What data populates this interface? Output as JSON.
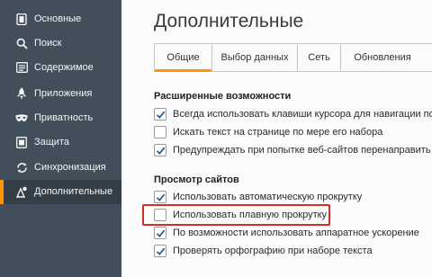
{
  "sidebar": {
    "items": [
      {
        "label": "Основные",
        "icon": "general-icon"
      },
      {
        "label": "Поиск",
        "icon": "search-icon"
      },
      {
        "label": "Содержимое",
        "icon": "content-icon"
      },
      {
        "label": "Приложения",
        "icon": "applications-icon"
      },
      {
        "label": "Приватность",
        "icon": "privacy-mask-icon"
      },
      {
        "label": "Защита",
        "icon": "security-icon"
      },
      {
        "label": "Синхронизация",
        "icon": "sync-icon"
      },
      {
        "label": "Дополнительные",
        "icon": "advanced-icon",
        "active": true
      }
    ]
  },
  "main": {
    "title": "Дополнительные",
    "tabs": [
      {
        "label": "Общие",
        "selected": true
      },
      {
        "label": "Выбор данных"
      },
      {
        "label": "Сеть"
      },
      {
        "label": "Обновления"
      }
    ],
    "sections": [
      {
        "title": "Расширенные возможности",
        "options": [
          {
            "label": "Всегда использовать клавиши курсора для навигации по стр",
            "checked": true
          },
          {
            "label": "Искать текст на странице по мере его набора",
            "checked": false
          },
          {
            "label": "Предупреждать при попытке веб-сайтов перенаправить или",
            "checked": true
          }
        ]
      },
      {
        "title": "Просмотр сайтов",
        "options": [
          {
            "label": "Использовать автоматическую прокрутку",
            "checked": true
          },
          {
            "label": "Использовать плавную прокрутку",
            "checked": false,
            "highlighted": true
          },
          {
            "label": "По возможности использовать аппаратное ускорение",
            "checked": true
          },
          {
            "label": "Проверять орфографию при наборе текста",
            "checked": true
          }
        ]
      }
    ]
  },
  "colors": {
    "sidebar_bg": "#424f5a",
    "accent": "#ff9500",
    "highlight": "#d32c2c",
    "checkmark": "#1e5b96"
  }
}
